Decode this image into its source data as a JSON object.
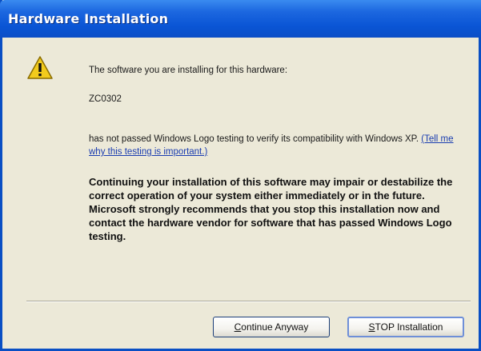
{
  "window": {
    "title": "Hardware Installation"
  },
  "icon": {
    "name": "warning-icon"
  },
  "message": {
    "line1": "The software you are installing for this hardware:",
    "device": "ZC0302",
    "line3_prefix": "has not passed Windows Logo testing to verify its compatibility with Windows XP. ",
    "link_text": "(Tell me why this testing is important.)",
    "warning": "Continuing your installation of this software may impair or destabilize the correct operation of your system either immediately or in the future. Microsoft strongly recommends that you stop this installation now and contact the hardware vendor for software that has passed Windows Logo testing."
  },
  "buttons": {
    "continue_first": "C",
    "continue_rest": "ontinue Anyway",
    "stop_first": "S",
    "stop_rest": "TOP Installation"
  },
  "colors": {
    "titlebar": "#0a55d5",
    "dialog_bg": "#ece9d8",
    "link": "#1a3db0"
  }
}
